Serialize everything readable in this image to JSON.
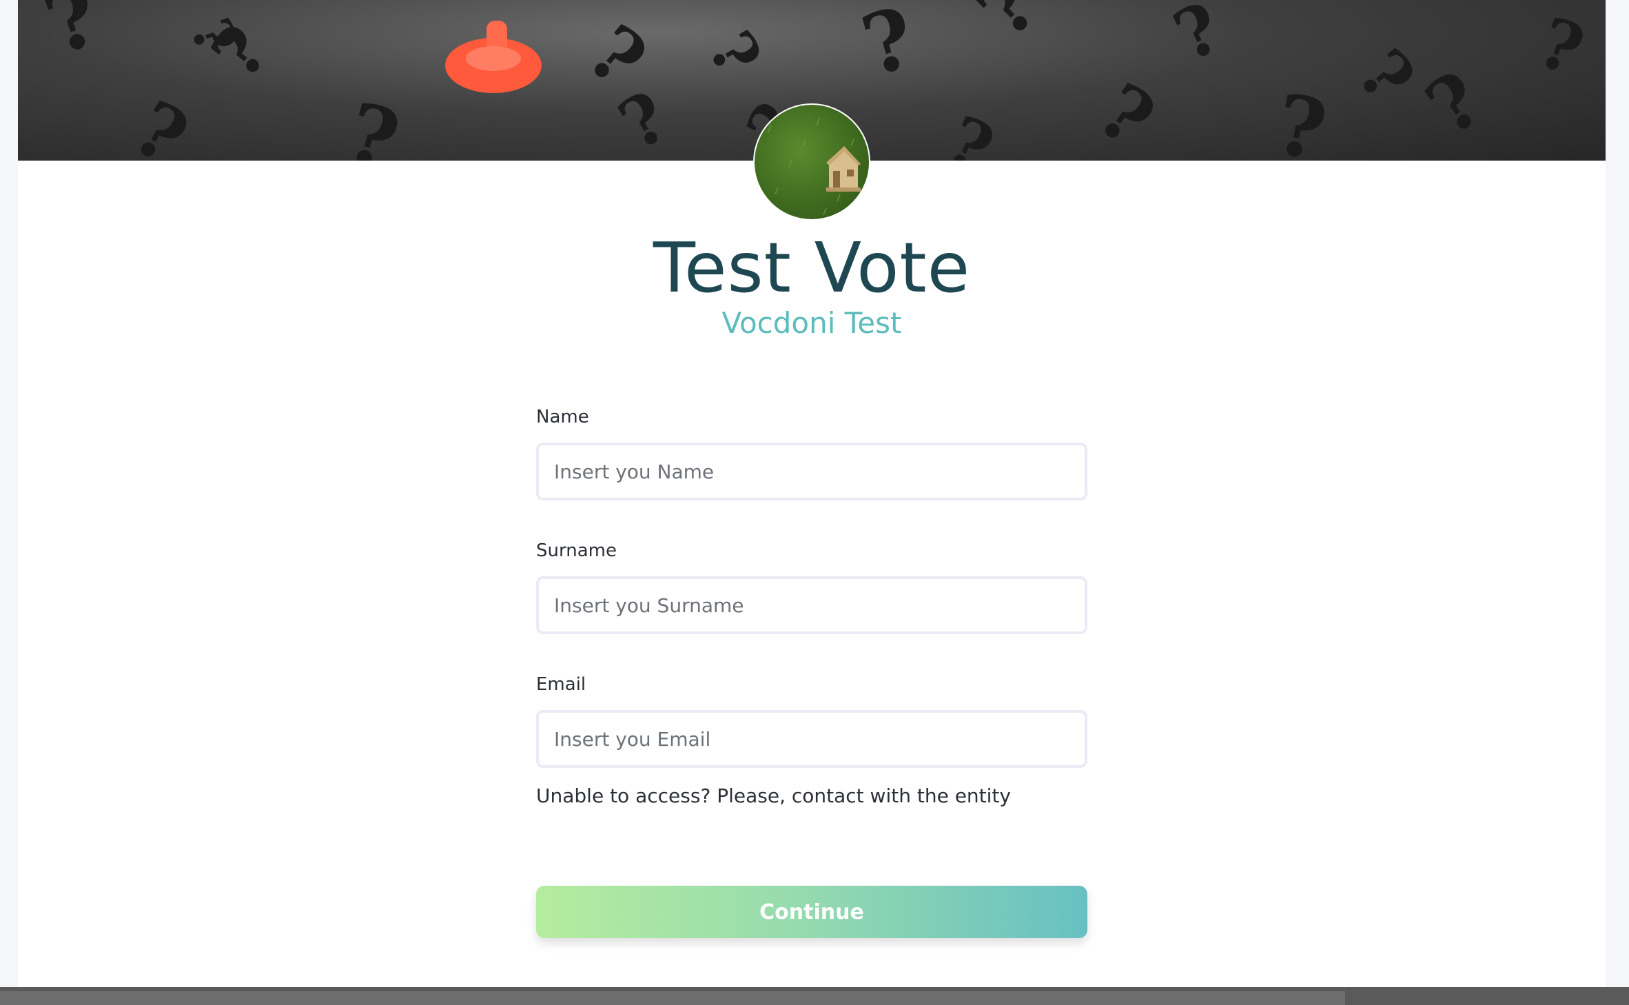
{
  "header": {
    "title": "Test Vote",
    "organization": "Vocdoni Test"
  },
  "form": {
    "name": {
      "label": "Name",
      "placeholder": "Insert you Name",
      "value": ""
    },
    "surname": {
      "label": "Surname",
      "placeholder": "Insert you Surname",
      "value": ""
    },
    "email": {
      "label": "Email",
      "placeholder": "Insert you Email",
      "value": ""
    },
    "help_text": "Unable to access? Please, contact with the entity",
    "submit_label": "Continue"
  },
  "colors": {
    "title": "#1e4752",
    "subtitle": "#5cbcbc",
    "button_gradient_start": "#b5ec9e",
    "button_gradient_end": "#68c0c2"
  },
  "icons": {
    "banner": "question-marks-banner-image",
    "avatar": "toy-house-on-grass-avatar"
  }
}
